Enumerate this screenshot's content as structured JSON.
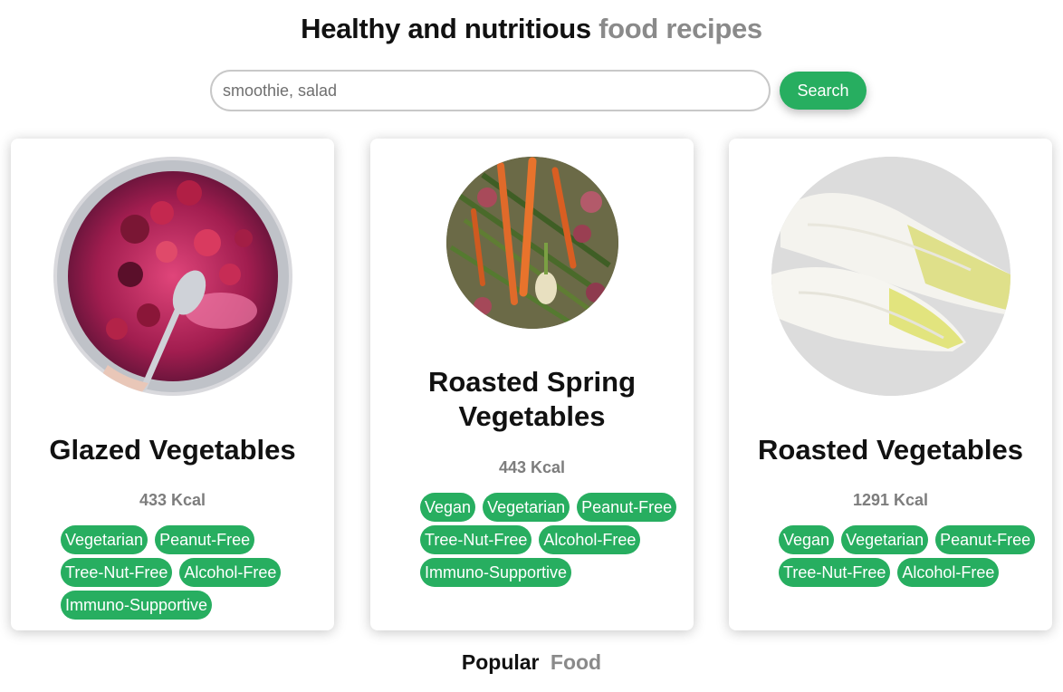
{
  "header": {
    "title_primary": "Healthy and nutritious",
    "title_secondary": "food recipes"
  },
  "search": {
    "placeholder": "smoothie, salad",
    "value": "",
    "button_label": "Search"
  },
  "recipes": [
    {
      "name": "Glazed Vegetables",
      "kcal": "433 Kcal",
      "tags": [
        "Vegetarian",
        "Peanut-Free",
        "Tree-Nut-Free",
        "Alcohol-Free",
        "Immuno-Supportive"
      ]
    },
    {
      "name": "Roasted Spring Vegetables",
      "kcal": "443 Kcal",
      "tags": [
        "Vegan",
        "Vegetarian",
        "Peanut-Free",
        "Tree-Nut-Free",
        "Alcohol-Free",
        "Immuno-Supportive"
      ]
    },
    {
      "name": "Roasted Vegetables",
      "kcal": "1291 Kcal",
      "tags": [
        "Vegan",
        "Vegetarian",
        "Peanut-Free",
        "Tree-Nut-Free",
        "Alcohol-Free"
      ]
    }
  ],
  "footer": {
    "label_primary": "Popular",
    "label_secondary": "Food"
  },
  "colors": {
    "accent": "#27ae60",
    "muted_text": "#8a8a8a"
  }
}
